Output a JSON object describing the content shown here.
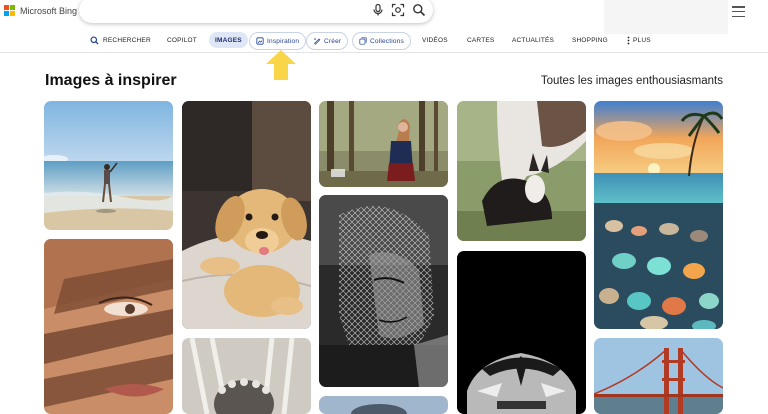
{
  "brand": {
    "name": "Microsoft Bing"
  },
  "search": {
    "placeholder": ""
  },
  "nav": {
    "items": [
      {
        "label": "RECHERCHER",
        "icon": "search-icon"
      },
      {
        "label": "COPILOT"
      },
      {
        "label": "IMAGES",
        "active": true
      },
      {
        "label": "Inspiration",
        "icon": "inspiration-icon"
      },
      {
        "label": "Créer",
        "icon": "create-icon"
      },
      {
        "label": "Collections",
        "icon": "collections-icon"
      },
      {
        "label": "VIDÉOS"
      },
      {
        "label": "CARTES"
      },
      {
        "label": "ACTUALITÉS"
      },
      {
        "label": "SHOPPING"
      },
      {
        "label": "PLUS",
        "icon": "more-dots-icon"
      }
    ]
  },
  "section": {
    "title": "Images à inspirer",
    "link": "Toutes les images enthousiasmants"
  },
  "colors": {
    "accent": "#1f3f8f",
    "arrow": "#f8d648"
  },
  "gallery": {
    "images": [
      {
        "id": "beach-child"
      },
      {
        "id": "puppy-on-bed"
      },
      {
        "id": "woman-in-forest"
      },
      {
        "id": "donkey-and-foal"
      },
      {
        "id": "sea-glass-beach-sunset"
      },
      {
        "id": "face-with-shadows"
      },
      {
        "id": "wire-sculpture-portrait"
      },
      {
        "id": "black-sports-car"
      },
      {
        "id": "bw-girl-flower-crown"
      },
      {
        "id": "golden-gate-bridge"
      },
      {
        "id": "bottom-partial"
      }
    ]
  }
}
